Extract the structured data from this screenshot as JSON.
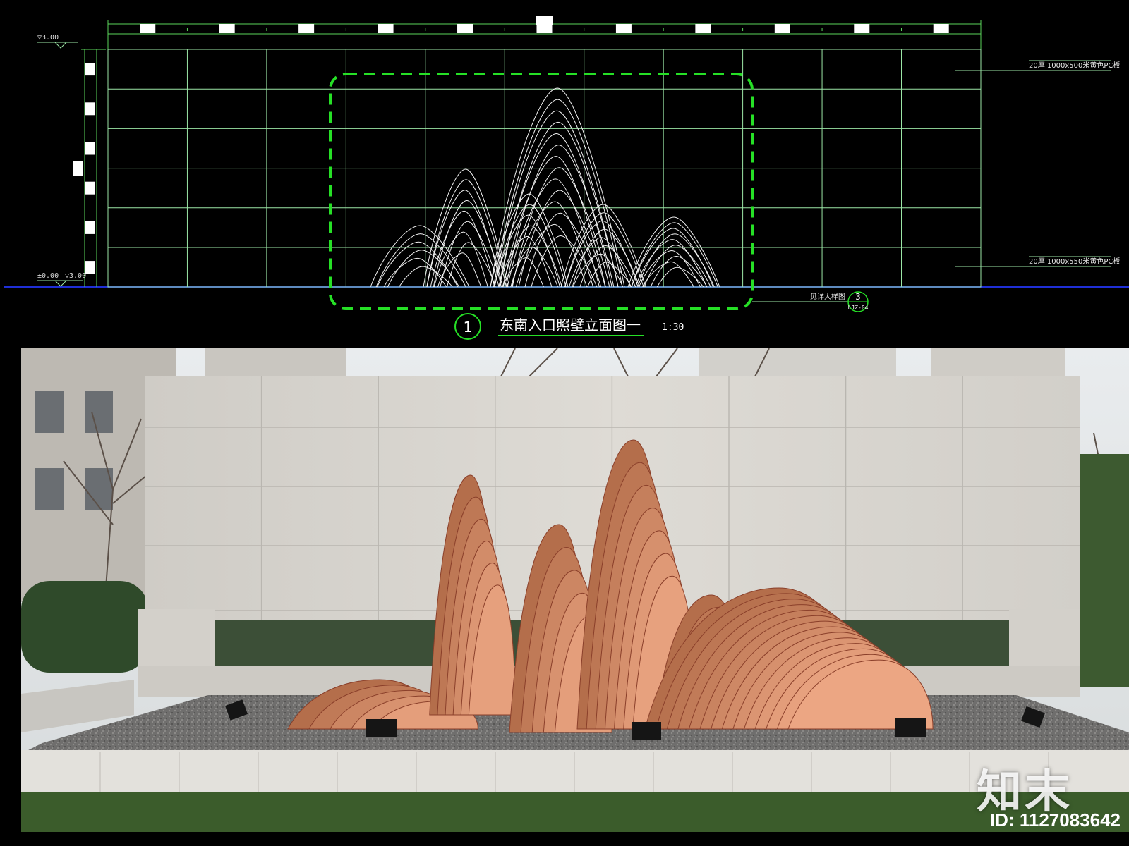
{
  "drawing": {
    "top_level": "▽3.00",
    "base_level": "±0.00",
    "base_level_alt": "▽3.00",
    "note_top": "20厚 1000x500米黄色PC板",
    "note_bottom": "20厚 1000x550米黄色PC板",
    "detail_ref_text": "见详大样图",
    "detail_ref_num": "3",
    "detail_ref_sheet": "LJZ-04",
    "title_num": "1",
    "title": "东南入口照壁立面图一",
    "scale": "1:30"
  },
  "photo": {
    "logo_text": "知末",
    "image_id": "ID: 1127083642"
  },
  "colors": {
    "cad_grid": "#9be6a6",
    "cad_dim": "#5ad55a",
    "cad_highlight": "#26e026",
    "ground_line": "#1f2fd6",
    "sculpture": "#b8654a",
    "wall": "#d8d5cf"
  }
}
